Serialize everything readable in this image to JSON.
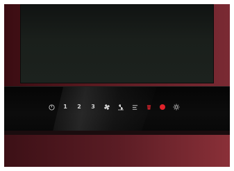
{
  "controls": {
    "power": {
      "icon": "power-icon"
    },
    "speed_1": {
      "label": "1"
    },
    "speed_2": {
      "label": "2"
    },
    "speed_3": {
      "label": "3"
    },
    "fan_boost": {
      "icon": "fan-icon"
    },
    "fan_intensive": {
      "icon": "fan-intensive-icon"
    },
    "timer": {
      "icon": "timer-icon"
    },
    "filter_alert": {
      "icon": "filter-icon",
      "color": "#c0232b"
    },
    "record": {
      "icon": "red-dot-icon",
      "color": "#e0222a"
    },
    "light": {
      "icon": "light-icon"
    }
  }
}
